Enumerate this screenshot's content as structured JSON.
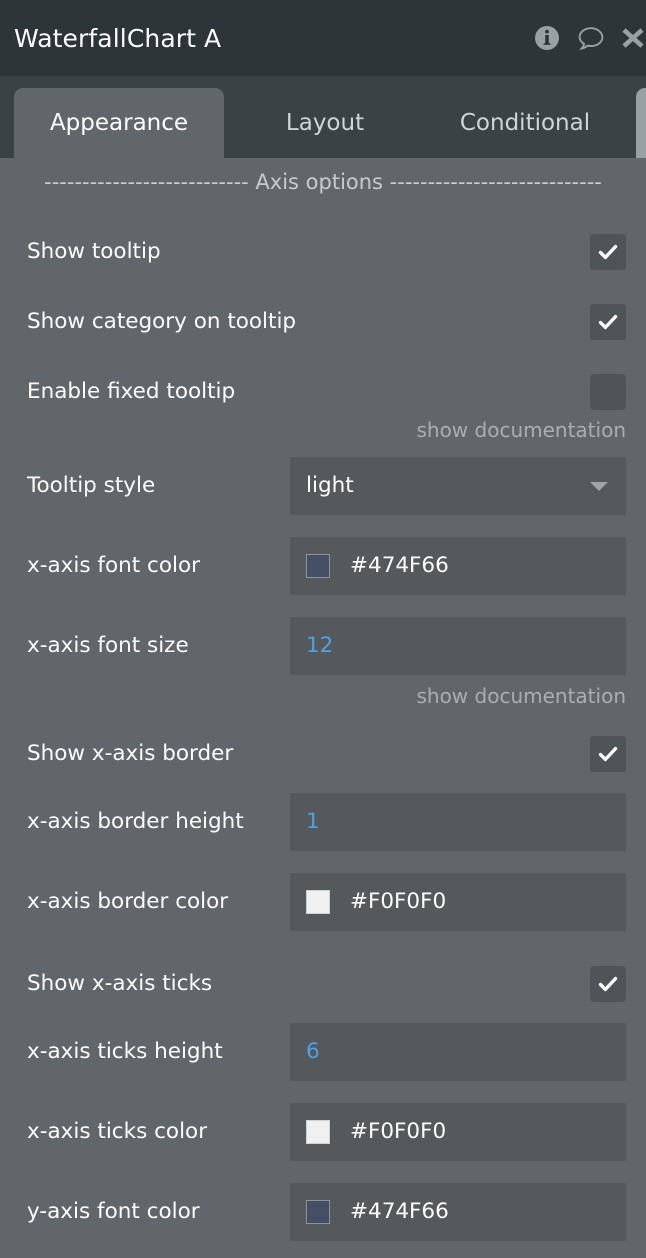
{
  "window": {
    "title": "WaterfallChart A",
    "icons": [
      {
        "name": "info-icon",
        "glyph": "info"
      },
      {
        "name": "comment-icon",
        "glyph": "comment"
      },
      {
        "name": "close-icon",
        "glyph": "close"
      }
    ]
  },
  "tabs": {
    "active": "Appearance",
    "items": [
      {
        "label": "Appearance"
      },
      {
        "label": "Layout"
      },
      {
        "label": "Conditional"
      }
    ]
  },
  "section": {
    "separator": "--------------------------- Axis options ----------------------------",
    "title": "Axis options"
  },
  "doc_link_label": "show documentation",
  "colors": {
    "header_bg": "#2E3538",
    "tabbar_bg": "#3B4245",
    "panel_bg": "#606669",
    "field_bg": "#55595C",
    "checkbox_bg": "#4E5457",
    "accent_number": "#4EA1E8",
    "text": "#FFFFFF",
    "muted_text": "#A9AEB2"
  },
  "options": [
    {
      "id": "show-tooltip",
      "label": "Show tooltip",
      "type": "checkbox",
      "checked": true
    },
    {
      "id": "show-category-on-tooltip",
      "label": "Show category on tooltip",
      "type": "checkbox",
      "checked": true
    },
    {
      "id": "enable-fixed-tooltip",
      "label": "Enable fixed tooltip",
      "type": "checkbox",
      "checked": false,
      "doc_link": "show documentation"
    },
    {
      "id": "tooltip-style",
      "label": "Tooltip style",
      "type": "select",
      "value": "light"
    },
    {
      "id": "x-axis-font-color",
      "label": "x-axis font color",
      "type": "color",
      "value": "#474F66",
      "swatch": "#474F66"
    },
    {
      "id": "x-axis-font-size",
      "label": "x-axis font size",
      "type": "number",
      "value": "12",
      "doc_link": "show documentation"
    },
    {
      "id": "show-x-axis-border",
      "label": "Show x-axis border",
      "type": "checkbox",
      "checked": true
    },
    {
      "id": "x-axis-border-height",
      "label": "x-axis border height",
      "type": "number",
      "value": "1"
    },
    {
      "id": "x-axis-border-color",
      "label": "x-axis border color",
      "type": "color",
      "value": "#F0F0F0",
      "swatch": "#F0F0F0"
    },
    {
      "id": "show-x-axis-ticks",
      "label": "Show x-axis ticks",
      "type": "checkbox",
      "checked": true
    },
    {
      "id": "x-axis-ticks-height",
      "label": "x-axis ticks height",
      "type": "number",
      "value": "6"
    },
    {
      "id": "x-axis-ticks-color",
      "label": "x-axis ticks color",
      "type": "color",
      "value": "#F0F0F0",
      "swatch": "#F0F0F0"
    },
    {
      "id": "y-axis-font-color",
      "label": "y-axis font color",
      "type": "color",
      "value": "#474F66",
      "swatch": "#474F66"
    }
  ]
}
